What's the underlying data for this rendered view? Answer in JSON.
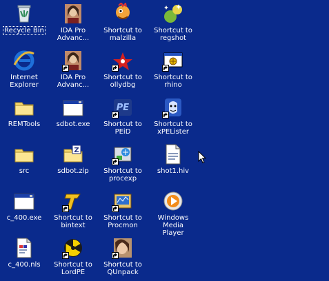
{
  "desktop": {
    "icons": [
      {
        "label": "Recycle Bin",
        "icon": "recycle-bin-icon",
        "col": 0,
        "row": 0,
        "shortcut": false,
        "selected": true
      },
      {
        "label": "IDA Pro\nAdvanc...",
        "icon": "ida-pro-icon",
        "col": 1,
        "row": 0,
        "shortcut": false
      },
      {
        "label": "Shortcut to\nmalzilla",
        "icon": "malzilla-icon",
        "col": 2,
        "row": 0,
        "shortcut": false
      },
      {
        "label": "Shortcut to\nregshot",
        "icon": "regshot-icon",
        "col": 3,
        "row": 0,
        "shortcut": false
      },
      {
        "label": "Internet\nExplorer",
        "icon": "internet-explorer-icon",
        "col": 0,
        "row": 1,
        "shortcut": false
      },
      {
        "label": "IDA Pro\nAdvanc...",
        "icon": "ida-pro-icon",
        "col": 1,
        "row": 1,
        "shortcut": true
      },
      {
        "label": "Shortcut to\nollydbg",
        "icon": "ollydbg-icon",
        "col": 2,
        "row": 1,
        "shortcut": true
      },
      {
        "label": "Shortcut to\nrhino",
        "icon": "rhino-icon",
        "col": 3,
        "row": 1,
        "shortcut": true
      },
      {
        "label": "REMTools",
        "icon": "folder-icon",
        "col": 0,
        "row": 2,
        "shortcut": false
      },
      {
        "label": "sdbot.exe",
        "icon": "exe-window-icon",
        "col": 1,
        "row": 2,
        "shortcut": false
      },
      {
        "label": "Shortcut to\nPEiD",
        "icon": "peid-icon",
        "col": 2,
        "row": 2,
        "shortcut": true
      },
      {
        "label": "Shortcut to\nxPELister",
        "icon": "xpelister-icon",
        "col": 3,
        "row": 2,
        "shortcut": true
      },
      {
        "label": "src",
        "icon": "folder-icon",
        "col": 0,
        "row": 3,
        "shortcut": false
      },
      {
        "label": "sdbot.zip",
        "icon": "zip-folder-icon",
        "col": 1,
        "row": 3,
        "shortcut": false
      },
      {
        "label": "Shortcut to\nprocexp",
        "icon": "procexp-icon",
        "col": 2,
        "row": 3,
        "shortcut": true
      },
      {
        "label": "shot1.hiv",
        "icon": "hiv-file-icon",
        "col": 3,
        "row": 3,
        "shortcut": false
      },
      {
        "label": "c_400.exe",
        "icon": "exe-window-icon",
        "col": 0,
        "row": 4,
        "shortcut": false
      },
      {
        "label": "Shortcut to\nbintext",
        "icon": "bintext-icon",
        "col": 1,
        "row": 4,
        "shortcut": true
      },
      {
        "label": "Shortcut to\nProcmon",
        "icon": "procmon-icon",
        "col": 2,
        "row": 4,
        "shortcut": true
      },
      {
        "label": "Windows Media\nPlayer",
        "icon": "media-player-icon",
        "col": 3,
        "row": 4,
        "shortcut": false
      },
      {
        "label": "c_400.nls",
        "icon": "nls-file-icon",
        "col": 0,
        "row": 5,
        "shortcut": false
      },
      {
        "label": "Shortcut to\nLordPE",
        "icon": "lordpe-icon",
        "col": 1,
        "row": 5,
        "shortcut": true
      },
      {
        "label": "Shortcut to\nQUnpack",
        "icon": "qunpack-icon",
        "col": 2,
        "row": 5,
        "shortcut": true
      }
    ]
  },
  "colors": {
    "desktop_bg": "#0a2a8c",
    "label_text": "#ffffff"
  }
}
